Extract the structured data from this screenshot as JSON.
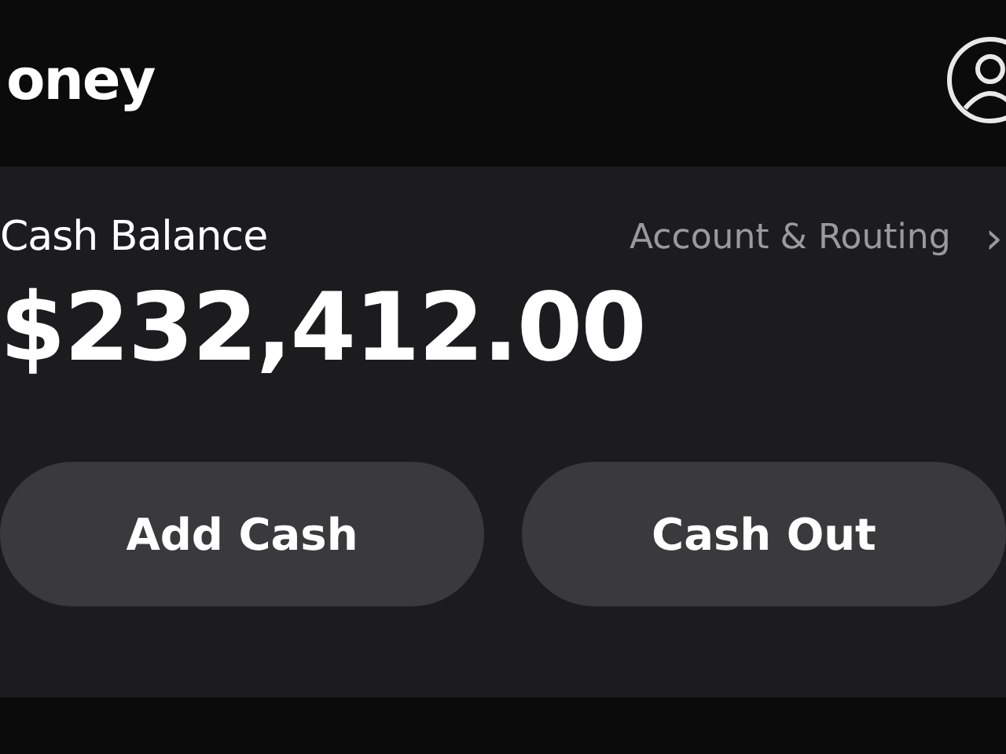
{
  "header": {
    "title": "oney"
  },
  "balance": {
    "label": "Cash Balance",
    "link": "Account & Routing",
    "chevron": "›",
    "amount": "$232,412.00"
  },
  "buttons": [
    {
      "label": "Add Cash"
    },
    {
      "label": "Cash Out"
    }
  ]
}
